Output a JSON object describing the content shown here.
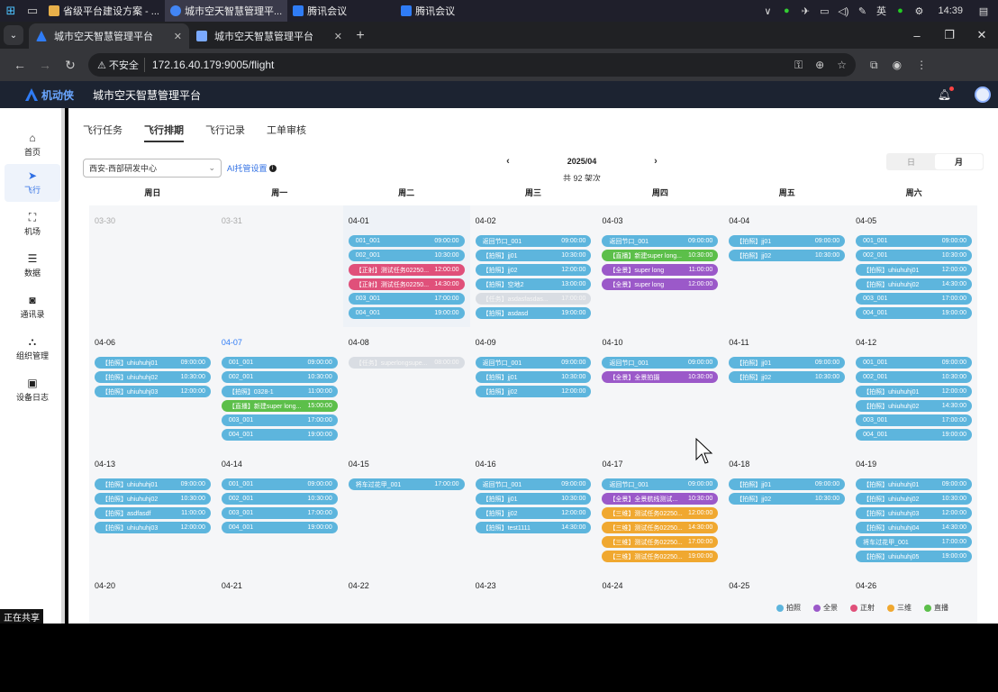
{
  "taskbar": {
    "apps": [
      {
        "label": "省级平台建设方案 - ...",
        "color": "#e8b04a"
      },
      {
        "label": "城市空天智慧管理平...",
        "color": "#4285f4"
      },
      {
        "label": "腾讯会议",
        "color": "#2f7cf6"
      },
      {
        "label": "腾讯会议",
        "color": "#2f7cf6"
      }
    ],
    "tray": [
      "∨",
      "●",
      "✈",
      "▭",
      "◁)",
      "✎",
      "英",
      "●",
      "⚙"
    ],
    "clock": "14:39"
  },
  "browser": {
    "tabs": [
      {
        "title": "城市空天智慧管理平台",
        "active": true
      },
      {
        "title": "城市空天智慧管理平台",
        "active": false
      }
    ],
    "security": "不安全",
    "url": "172.16.40.179:9005/flight"
  },
  "app": {
    "logo_text": "机动侠",
    "title": "城市空天智慧管理平台"
  },
  "sidebar": [
    {
      "label": "首页",
      "icon": "⌂"
    },
    {
      "label": "飞行",
      "icon": "➤"
    },
    {
      "label": "机场",
      "icon": "⛶"
    },
    {
      "label": "数据",
      "icon": "☰"
    },
    {
      "label": "通讯录",
      "icon": "◙"
    },
    {
      "label": "组织管理",
      "icon": "⛬"
    },
    {
      "label": "设备日志",
      "icon": "▣"
    }
  ],
  "sub_tabs": [
    "飞行任务",
    "飞行排期",
    "飞行记录",
    "工单审核"
  ],
  "filter": {
    "site": "西安-西部研发中心",
    "ai_link": "AI托管设置"
  },
  "month_nav": {
    "month": "2025/04",
    "count": "共 92 架次"
  },
  "view_toggle": {
    "day": "日",
    "month": "月"
  },
  "weekdays": [
    "周日",
    "周一",
    "周二",
    "周三",
    "周四",
    "周五",
    "周六"
  ],
  "colors": {
    "photo": "#5db5dd",
    "panorama": "#9b59c9",
    "ortho": "#e0507a",
    "3d": "#f0a830",
    "live": "#5cbf4a"
  },
  "weeks": [
    [
      {
        "date": "03-30",
        "muted": true,
        "events": []
      },
      {
        "date": "03-31",
        "muted": true,
        "events": []
      },
      {
        "date": "04-01",
        "today": true,
        "events": [
          {
            "name": "001_001",
            "time": "09:00:00",
            "type": "photo"
          },
          {
            "name": "002_001",
            "time": "10:30:00",
            "type": "photo"
          },
          {
            "name": "【正射】测试任务02250...",
            "time": "12:00:00",
            "type": "ortho"
          },
          {
            "name": "【正射】测试任务02250...",
            "time": "14:30:00",
            "type": "ortho"
          },
          {
            "name": "003_001",
            "time": "17:00:00",
            "type": "photo"
          },
          {
            "name": "004_001",
            "time": "19:00:00",
            "type": "photo"
          }
        ]
      },
      {
        "date": "04-02",
        "events": [
          {
            "name": "返回节口_001",
            "time": "09:00:00",
            "type": "photo"
          },
          {
            "name": "【拍照】jj01",
            "time": "10:30:00",
            "type": "photo"
          },
          {
            "name": "【拍照】jj02",
            "time": "12:00:00",
            "type": "photo"
          },
          {
            "name": "【拍照】空地2",
            "time": "13:00:00",
            "type": "photo"
          },
          {
            "name": "【任务】asdasfasdas...",
            "time": "17:00:00",
            "type": "faded"
          },
          {
            "name": "【拍照】asdasd",
            "time": "19:00:00",
            "type": "photo"
          }
        ]
      },
      {
        "date": "04-03",
        "events": [
          {
            "name": "返回节口_001",
            "time": "09:00:00",
            "type": "photo"
          },
          {
            "name": "【直播】新建super long...",
            "time": "10:30:00",
            "type": "live"
          },
          {
            "name": "【全景】super long",
            "time": "11:00:00",
            "type": "panorama"
          },
          {
            "name": "【全景】super long",
            "time": "12:00:00",
            "type": "panorama"
          }
        ]
      },
      {
        "date": "04-04",
        "events": [
          {
            "name": "【拍照】jj01",
            "time": "09:00:00",
            "type": "photo"
          },
          {
            "name": "【拍照】jj02",
            "time": "10:30:00",
            "type": "photo"
          }
        ]
      },
      {
        "date": "04-05",
        "events": [
          {
            "name": "001_001",
            "time": "09:00:00",
            "type": "photo"
          },
          {
            "name": "002_001",
            "time": "10:30:00",
            "type": "photo"
          },
          {
            "name": "【拍照】uhiuhuhj01",
            "time": "12:00:00",
            "type": "photo"
          },
          {
            "name": "【拍照】uhiuhuhj02",
            "time": "14:30:00",
            "type": "photo"
          },
          {
            "name": "003_001",
            "time": "17:00:00",
            "type": "photo"
          },
          {
            "name": "004_001",
            "time": "19:00:00",
            "type": "photo"
          }
        ]
      }
    ],
    [
      {
        "date": "04-06",
        "events": [
          {
            "name": "【拍照】uhiuhuhj01",
            "time": "09:00:00",
            "type": "photo"
          },
          {
            "name": "【拍照】uhiuhuhj02",
            "time": "10:30:00",
            "type": "photo"
          },
          {
            "name": "【拍照】uhiuhuhj03",
            "time": "12:00:00",
            "type": "photo"
          }
        ]
      },
      {
        "date": "04-07",
        "blue": true,
        "events": [
          {
            "name": "001_001",
            "time": "09:00:00",
            "type": "photo"
          },
          {
            "name": "002_001",
            "time": "10:30:00",
            "type": "photo"
          },
          {
            "name": "【拍照】0328-1",
            "time": "11:00:00",
            "type": "photo"
          },
          {
            "name": "【直播】新建super long...",
            "time": "15:00:00",
            "type": "live"
          },
          {
            "name": "003_001",
            "time": "17:00:00",
            "type": "photo"
          },
          {
            "name": "004_001",
            "time": "19:00:00",
            "type": "photo"
          }
        ]
      },
      {
        "date": "04-08",
        "events": [
          {
            "name": "【任务】superlongsupe...",
            "time": "08:00:00",
            "type": "faded"
          }
        ]
      },
      {
        "date": "04-09",
        "events": [
          {
            "name": "返回节口_001",
            "time": "09:00:00",
            "type": "photo"
          },
          {
            "name": "【拍照】jj01",
            "time": "10:30:00",
            "type": "photo"
          },
          {
            "name": "【拍照】jj02",
            "time": "12:00:00",
            "type": "photo"
          }
        ]
      },
      {
        "date": "04-10",
        "events": [
          {
            "name": "返回节口_001",
            "time": "09:00:00",
            "type": "photo"
          },
          {
            "name": "【全景】全景拍摄",
            "time": "10:30:00",
            "type": "panorama"
          }
        ]
      },
      {
        "date": "04-11",
        "events": [
          {
            "name": "【拍照】jj01",
            "time": "09:00:00",
            "type": "photo"
          },
          {
            "name": "【拍照】jj02",
            "time": "10:30:00",
            "type": "photo"
          }
        ]
      },
      {
        "date": "04-12",
        "events": [
          {
            "name": "001_001",
            "time": "09:00:00",
            "type": "photo"
          },
          {
            "name": "002_001",
            "time": "10:30:00",
            "type": "photo"
          },
          {
            "name": "【拍照】uhiuhuhj01",
            "time": "12:00:00",
            "type": "photo"
          },
          {
            "name": "【拍照】uhiuhuhj02",
            "time": "14:30:00",
            "type": "photo"
          },
          {
            "name": "003_001",
            "time": "17:00:00",
            "type": "photo"
          },
          {
            "name": "004_001",
            "time": "19:00:00",
            "type": "photo"
          }
        ]
      }
    ],
    [
      {
        "date": "04-13",
        "events": [
          {
            "name": "【拍照】uhiuhuhj01",
            "time": "09:00:00",
            "type": "photo"
          },
          {
            "name": "【拍照】uhiuhuhj02",
            "time": "10:30:00",
            "type": "photo"
          },
          {
            "name": "【拍照】asdfasdf",
            "time": "11:00:00",
            "type": "photo"
          },
          {
            "name": "【拍照】uhiuhuhj03",
            "time": "12:00:00",
            "type": "photo"
          }
        ]
      },
      {
        "date": "04-14",
        "events": [
          {
            "name": "001_001",
            "time": "09:00:00",
            "type": "photo"
          },
          {
            "name": "002_001",
            "time": "10:30:00",
            "type": "photo"
          },
          {
            "name": "003_001",
            "time": "17:00:00",
            "type": "photo"
          },
          {
            "name": "004_001",
            "time": "19:00:00",
            "type": "photo"
          }
        ]
      },
      {
        "date": "04-15",
        "events": [
          {
            "name": "将车过花甲_001",
            "time": "17:00:00",
            "type": "photo"
          }
        ]
      },
      {
        "date": "04-16",
        "events": [
          {
            "name": "返回节口_001",
            "time": "09:00:00",
            "type": "photo"
          },
          {
            "name": "【拍照】jj01",
            "time": "10:30:00",
            "type": "photo"
          },
          {
            "name": "【拍照】jj02",
            "time": "12:00:00",
            "type": "photo"
          },
          {
            "name": "【拍照】test1111",
            "time": "14:30:00",
            "type": "photo"
          }
        ]
      },
      {
        "date": "04-17",
        "events": [
          {
            "name": "返回节口_001",
            "time": "09:00:00",
            "type": "photo"
          },
          {
            "name": "【全景】全景航线测试...",
            "time": "10:30:00",
            "type": "panorama"
          },
          {
            "name": "【三维】测试任务02250...",
            "time": "12:00:00",
            "type": "3d"
          },
          {
            "name": "【三维】测试任务02250...",
            "time": "14:30:00",
            "type": "3d"
          },
          {
            "name": "【三维】测试任务02250...",
            "time": "17:00:00",
            "type": "3d"
          },
          {
            "name": "【三维】测试任务02250...",
            "time": "19:00:00",
            "type": "3d"
          }
        ]
      },
      {
        "date": "04-18",
        "events": [
          {
            "name": "【拍照】jj01",
            "time": "09:00:00",
            "type": "photo"
          },
          {
            "name": "【拍照】jj02",
            "time": "10:30:00",
            "type": "photo"
          }
        ]
      },
      {
        "date": "04-19",
        "events": [
          {
            "name": "【拍照】uhiuhuhj01",
            "time": "09:00:00",
            "type": "photo"
          },
          {
            "name": "【拍照】uhiuhuhj02",
            "time": "10:30:00",
            "type": "photo"
          },
          {
            "name": "【拍照】uhiuhuhj03",
            "time": "12:00:00",
            "type": "photo"
          },
          {
            "name": "【拍照】uhiuhuhj04",
            "time": "14:30:00",
            "type": "photo"
          },
          {
            "name": "将车过花甲_001",
            "time": "17:00:00",
            "type": "photo"
          },
          {
            "name": "【拍照】uhiuhuhj05",
            "time": "19:00:00",
            "type": "photo"
          }
        ]
      }
    ],
    [
      {
        "date": "04-20",
        "events": []
      },
      {
        "date": "04-21",
        "events": []
      },
      {
        "date": "04-22",
        "events": []
      },
      {
        "date": "04-23",
        "events": []
      },
      {
        "date": "04-24",
        "events": []
      },
      {
        "date": "04-25",
        "events": []
      },
      {
        "date": "04-26",
        "events": []
      }
    ]
  ],
  "legend": [
    {
      "label": "拍照",
      "type": "photo"
    },
    {
      "label": "全景",
      "type": "panorama"
    },
    {
      "label": "正射",
      "type": "ortho"
    },
    {
      "label": "三维",
      "type": "3d"
    },
    {
      "label": "直播",
      "type": "live"
    }
  ],
  "screen_share": "正在共享"
}
